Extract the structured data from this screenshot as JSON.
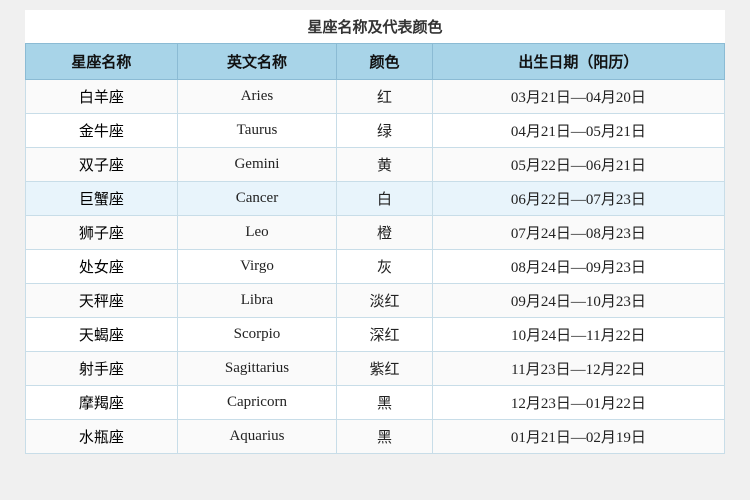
{
  "title": "星座名称及代表颜色",
  "headers": [
    "星座名称",
    "英文名称",
    "颜色",
    "出生日期（阳历）"
  ],
  "rows": [
    {
      "zh": "白羊座",
      "en": "Aries",
      "color": "红",
      "date": "03月21日—04月20日"
    },
    {
      "zh": "金牛座",
      "en": "Taurus",
      "color": "绿",
      "date": "04月21日—05月21日"
    },
    {
      "zh": "双子座",
      "en": "Gemini",
      "color": "黄",
      "date": "05月22日—06月21日"
    },
    {
      "zh": "巨蟹座",
      "en": "Cancer",
      "color": "白",
      "date": "06月22日—07月23日"
    },
    {
      "zh": "狮子座",
      "en": "Leo",
      "color": "橙",
      "date": "07月24日—08月23日"
    },
    {
      "zh": "处女座",
      "en": "Virgo",
      "color": "灰",
      "date": "08月24日—09月23日"
    },
    {
      "zh": "天秤座",
      "en": "Libra",
      "color": "淡红",
      "date": "09月24日—10月23日"
    },
    {
      "zh": "天蝎座",
      "en": "Scorpio",
      "color": "深红",
      "date": "10月24日—11月22日"
    },
    {
      "zh": "射手座",
      "en": "Sagittarius",
      "color": "紫红",
      "date": "11月23日—12月22日"
    },
    {
      "zh": "摩羯座",
      "en": "Capricorn",
      "color": "黑",
      "date": "12月23日—01月22日"
    },
    {
      "zh": "水瓶座",
      "en": "Aquarius",
      "color": "黑",
      "date": "01月21日—02月19日"
    }
  ]
}
